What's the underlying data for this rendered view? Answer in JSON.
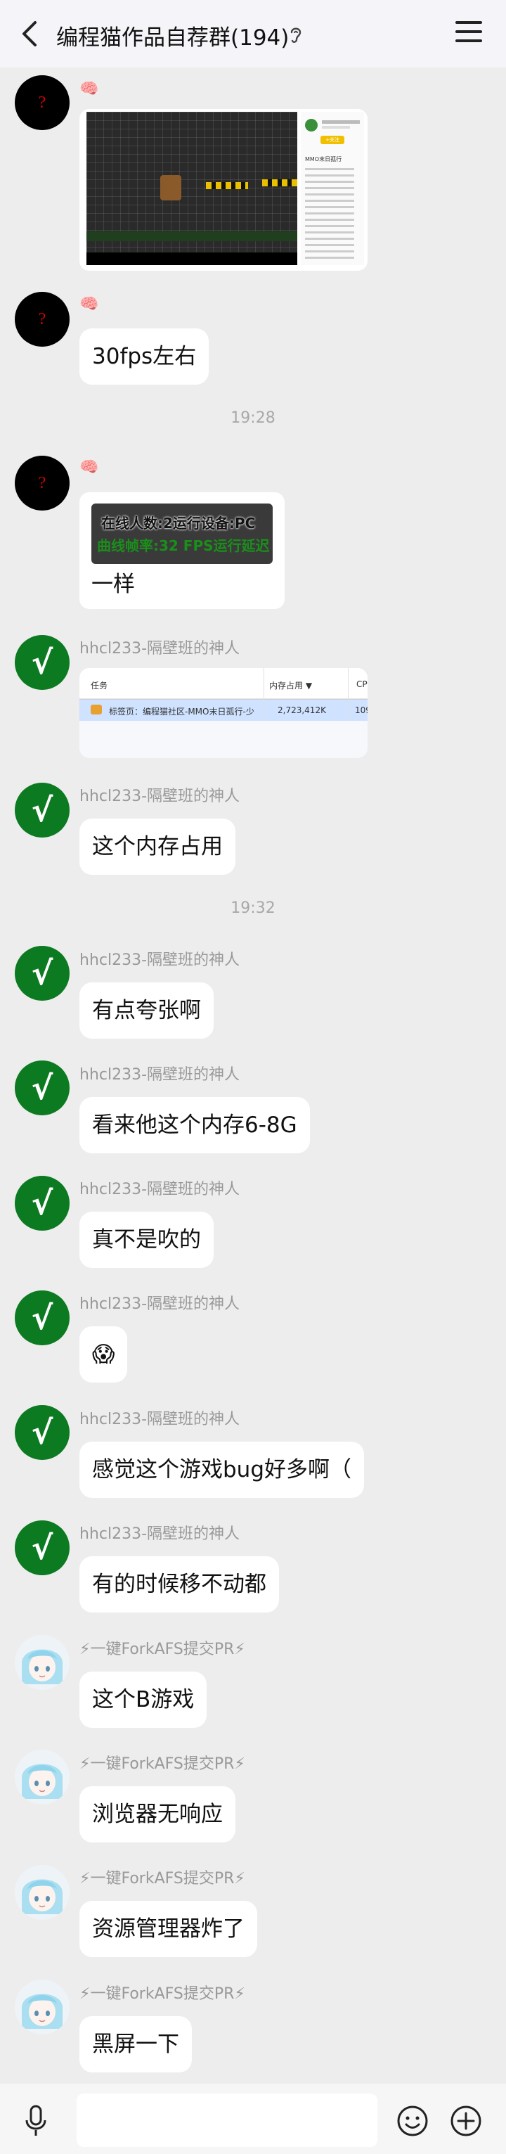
{
  "header": {
    "title": "编程猫作品自荐群(194)"
  },
  "avatars": {
    "question_mark": "?",
    "check_mark": "√"
  },
  "messages": [
    {
      "sender": "🧠",
      "type": "image",
      "image_text": ""
    },
    {
      "sender": "🧠",
      "type": "text",
      "text": "30fps左右"
    },
    {
      "sender": "🧠",
      "type": "image_text",
      "image_text_line1": "在线人数:2运行设备:PC",
      "image_text_line2": "曲线帧率:32 FPS运行延迟",
      "text": "一样"
    },
    {
      "sender": "hhcl233-隔壁班的神人",
      "type": "task_manager",
      "task_col": "任务",
      "mem_col": "内存占用 ▼",
      "cpu_col": "CP",
      "row_name": "标签页：编程猫社区-MMO末日孤行-少",
      "row_mem": "2,723,412K",
      "row_cpu": "109"
    },
    {
      "sender": "hhcl233-隔壁班的神人",
      "type": "text",
      "text": "这个内存占用"
    },
    {
      "sender": "hhcl233-隔壁班的神人",
      "type": "text",
      "text": "有点夸张啊"
    },
    {
      "sender": "hhcl233-隔壁班的神人",
      "type": "text",
      "text": "看来他这个内存6-8G"
    },
    {
      "sender": "hhcl233-隔壁班的神人",
      "type": "text",
      "text": "真不是吹的"
    },
    {
      "sender": "hhcl233-隔壁班的神人",
      "type": "text",
      "text": "😱"
    },
    {
      "sender": "hhcl233-隔壁班的神人",
      "type": "text",
      "text": "感觉这个游戏bug好多啊（"
    },
    {
      "sender": "hhcl233-隔壁班的神人",
      "type": "text",
      "text": "有的时候移不动都"
    },
    {
      "sender": "⚡一键ForkAFS提交PR⚡",
      "type": "text",
      "text": "这个B游戏"
    },
    {
      "sender": "⚡一键ForkAFS提交PR⚡",
      "type": "text",
      "text": "浏览器无响应"
    },
    {
      "sender": "⚡一键ForkAFS提交PR⚡",
      "type": "text",
      "text": "资源管理器炸了"
    },
    {
      "sender": "⚡一键ForkAFS提交PR⚡",
      "type": "text",
      "text": "黑屏一下"
    }
  ],
  "timestamps": [
    "19:28",
    "19:32"
  ],
  "side_panel": {
    "title": "MMO末日孤行",
    "button": "+关注"
  },
  "colors": {
    "background": "#ededed",
    "bubble": "#ffffff",
    "check_avatar": "#0c7a20"
  }
}
